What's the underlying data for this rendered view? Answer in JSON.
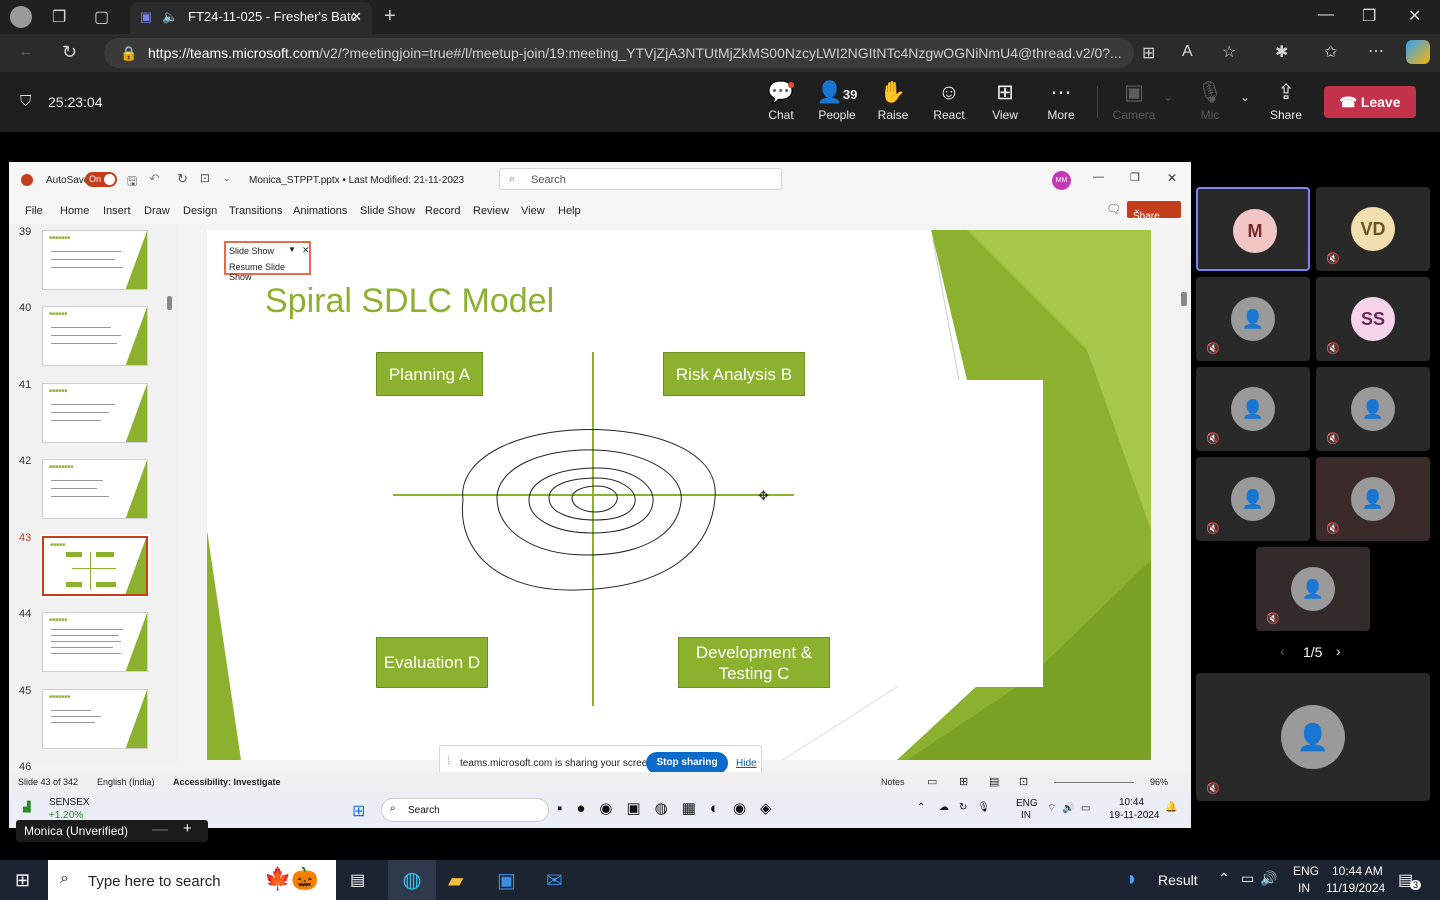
{
  "browser": {
    "tab_title": "FT24-11-025 - Fresher's Batc",
    "url_host": "https://teams.microsoft.com",
    "url_path": "/v2/?meetingjoin=true#/l/meetup-join/19:meeting_YTVjZjA3NTUtMjZkMS00NzcyLWI2NGItNTc4NzgwOGNiNmU4@thread.v2/0?..."
  },
  "meeting": {
    "timer": "25:23:04",
    "people_count": "39",
    "controls": {
      "chat": "Chat",
      "people": "People",
      "raise": "Raise",
      "react": "React",
      "view": "View",
      "more": "More",
      "camera": "Camera",
      "mic": "Mic",
      "share": "Share",
      "leave": "Leave"
    }
  },
  "ppt": {
    "autosave": "AutoSave",
    "toggle": "On",
    "filename": "Monica_STPPT.pptx • Last Modified: 21-11-2023",
    "search_placeholder": "Search",
    "user_initials": "MM",
    "menu": [
      "File",
      "Home",
      "Insert",
      "Draw",
      "Design",
      "Transitions",
      "Animations",
      "Slide Show",
      "Record",
      "Review",
      "View",
      "Help"
    ],
    "share": "Share",
    "slide_numbers": [
      "39",
      "40",
      "41",
      "42",
      "43",
      "44",
      "45",
      "46"
    ],
    "slideshow_popup": {
      "title": "Slide Show",
      "resume": "Resume Slide Show"
    },
    "slide": {
      "title": "Spiral SDLC Model",
      "quadrants": {
        "q1": "Planning A",
        "q2": "Risk Analysis B",
        "q3": "Evaluation D",
        "q4": "Development & Testing C"
      }
    },
    "status": {
      "slide": "Slide 43 of 342",
      "language": "English (India)",
      "accessibility": "Accessibility: Investigate",
      "notes": "Notes",
      "zoom": "96%"
    },
    "sharing_bar": {
      "text": "teams.microsoft.com is sharing your screen.",
      "stop": "Stop sharing",
      "hide": "Hide"
    }
  },
  "inner_taskbar": {
    "sensex": "SENSEX",
    "sensex_change": "+1.20%",
    "search": "Search",
    "lang1": "ENG",
    "lang2": "IN",
    "time": "10:44",
    "date": "19-11-2024"
  },
  "presenter_label": "Monica (Unverified)",
  "participants": [
    {
      "initials": "M",
      "color": "#f2c6c4",
      "text": "#7a2a2a"
    },
    {
      "initials": "VD",
      "color": "#f2dfb0",
      "text": "#6a5420"
    },
    {
      "initials": "",
      "color": "#9a9a9a",
      "text": "#fff"
    },
    {
      "initials": "SS",
      "color": "#f5d3e8",
      "text": "#6b2a55"
    },
    {
      "initials": "",
      "color": "#9a9a9a",
      "text": "#fff"
    },
    {
      "initials": "",
      "color": "#9a9a9a",
      "text": "#fff"
    },
    {
      "initials": "",
      "color": "#9a9a9a",
      "text": "#fff"
    },
    {
      "initials": "",
      "color": "#9a9a9a",
      "text": "#fff"
    },
    {
      "initials": "",
      "color": "#9a9a9a",
      "text": "#fff"
    }
  ],
  "pager": "1/5",
  "taskbar": {
    "search": "Type here to search",
    "result": "Result",
    "lang1": "ENG",
    "lang2": "IN",
    "time": "10:44 AM",
    "date": "11/19/2024",
    "notif": "3"
  }
}
